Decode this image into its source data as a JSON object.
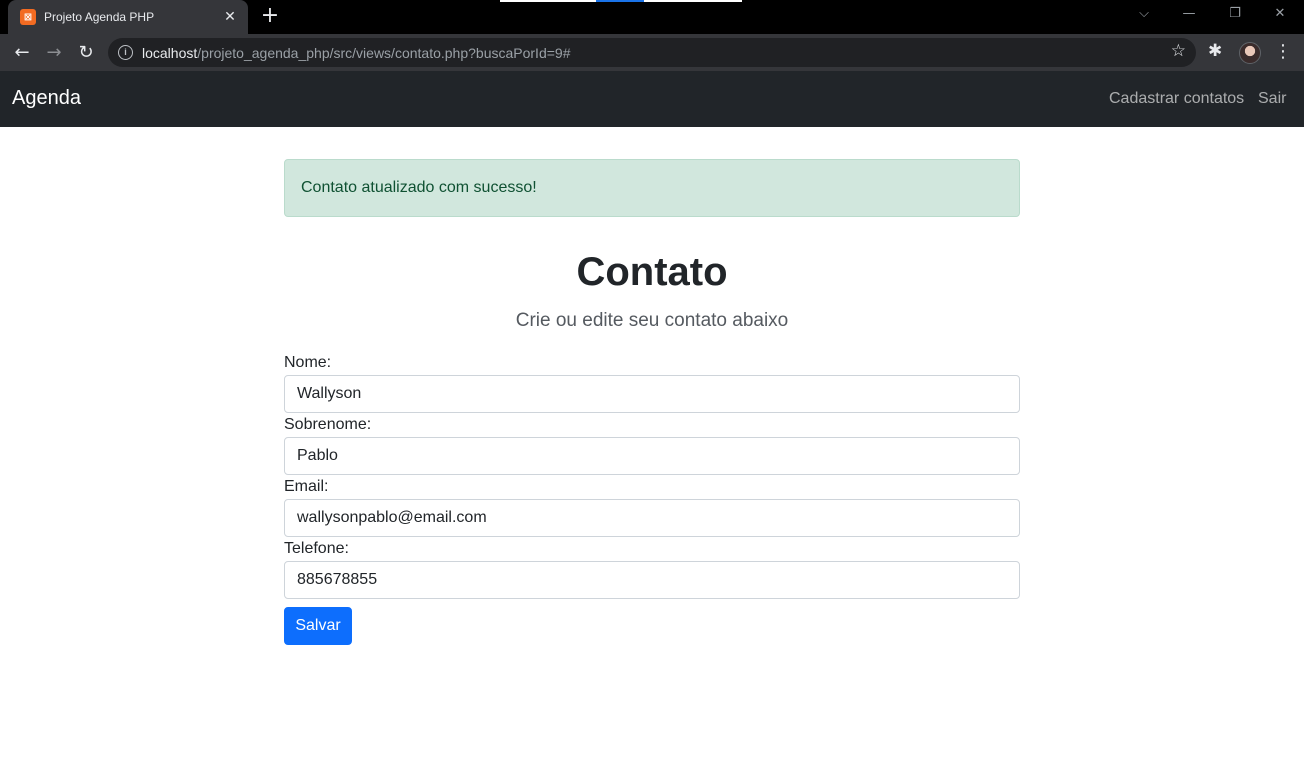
{
  "browser": {
    "tab_title": "Projeto Agenda PHP",
    "tab_favicon": "xampp-icon",
    "new_tab": "+",
    "tab_close": "✕",
    "url_host": "localhost",
    "url_path": "/projeto_agenda_php/src/views/contato.php?buscaPorId=9#"
  },
  "navbar": {
    "brand": "Agenda",
    "links": [
      {
        "label": "Cadastrar contatos"
      },
      {
        "label": "Sair"
      }
    ]
  },
  "alert": {
    "message": "Contato atualizado com sucesso!",
    "color": "#d1e7dd"
  },
  "page": {
    "title": "Contato",
    "subtitle": "Crie ou edite seu contato abaixo"
  },
  "form": {
    "fields": [
      {
        "label": "Nome:",
        "value": "Wallyson"
      },
      {
        "label": "Sobrenome:",
        "value": "Pablo"
      },
      {
        "label": "Email:",
        "value": "wallysonpablo@email.com"
      },
      {
        "label": "Telefone:",
        "value": "885678855"
      }
    ],
    "submit_label": "Salvar",
    "submit_color": "#0d6efd"
  }
}
